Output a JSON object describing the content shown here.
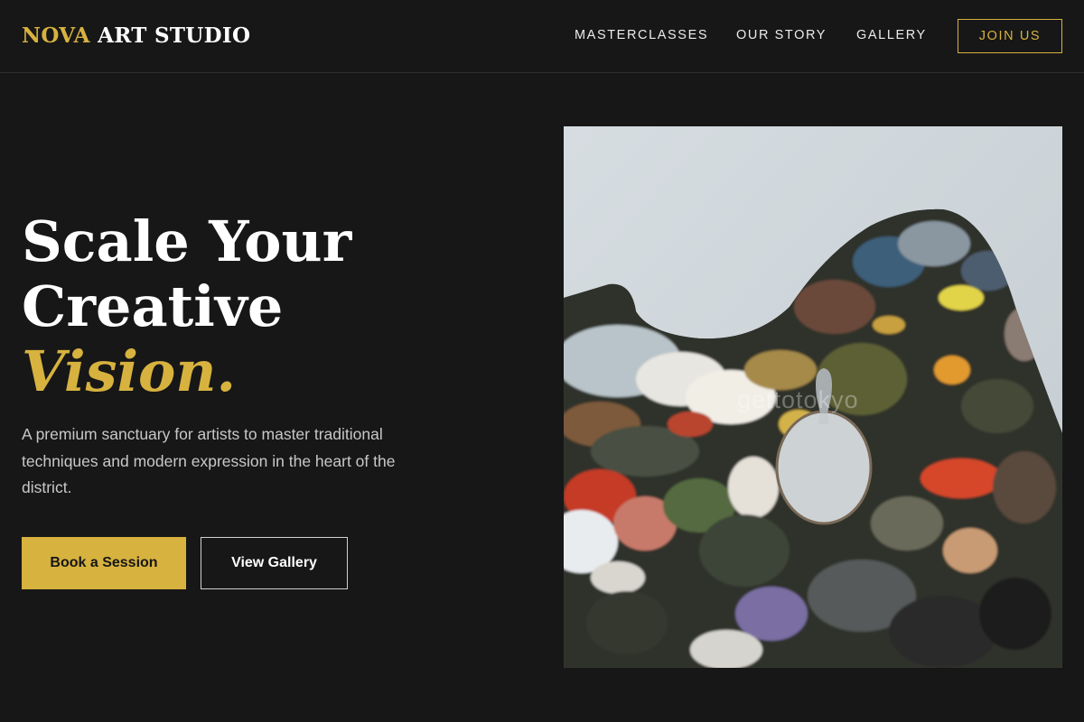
{
  "header": {
    "logo_accent": "NOVA",
    "logo_rest": "ART STUDIO",
    "nav": [
      "MASTERCLASSES",
      "OUR STORY",
      "GALLERY"
    ],
    "cta": "JOIN US"
  },
  "hero": {
    "title_line1": "Scale Your",
    "title_line2": "Creative",
    "title_line3": "Vision.",
    "description": "A premium sanctuary for artists to master traditional techniques and modern expression in the heart of the district.",
    "primary_button": "Book a Session",
    "secondary_button": "View Gallery",
    "image_watermark": "gettotokyo"
  },
  "colors": {
    "background": "#171717",
    "accent": "#d7b23f",
    "text": "#ffffff",
    "muted_text": "#c8c8c8"
  },
  "icons": {
    "hero_image": "paint-palette-photo"
  }
}
